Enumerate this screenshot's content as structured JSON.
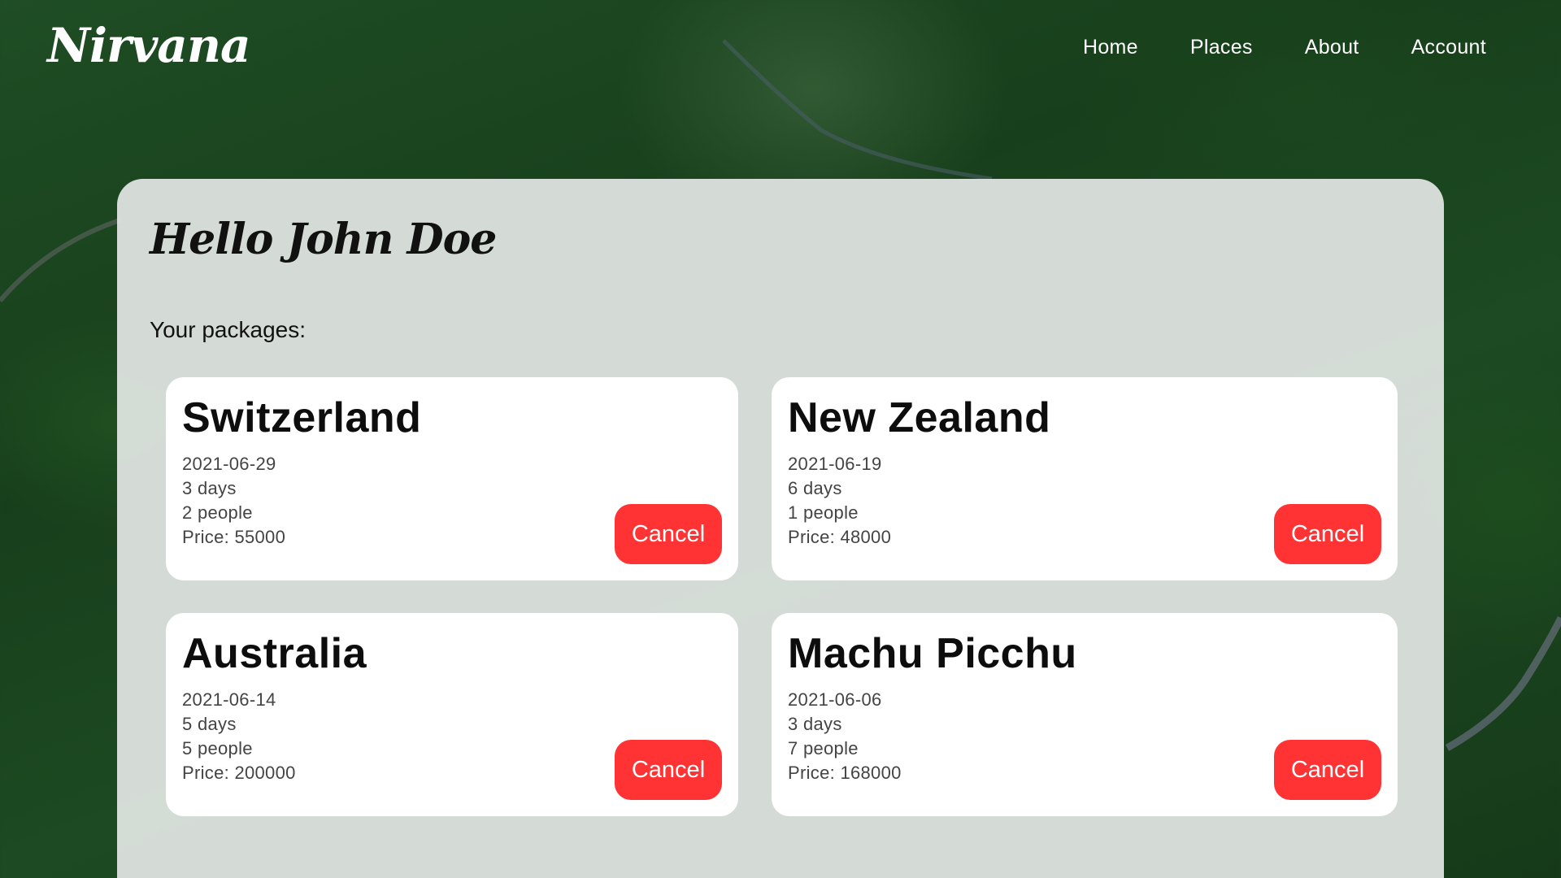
{
  "brand": {
    "logo": "Nirvana"
  },
  "nav": {
    "items": [
      {
        "label": "Home"
      },
      {
        "label": "Places"
      },
      {
        "label": "About"
      },
      {
        "label": "Account"
      }
    ]
  },
  "main": {
    "greeting": "Hello John Doe",
    "packages_label": "Your packages:",
    "packages": [
      {
        "destination": "Switzerland",
        "date": "2021-06-29",
        "duration": "3 days",
        "people": "2 people",
        "price": "Price: 55000",
        "cancel_label": "Cancel"
      },
      {
        "destination": "New Zealand",
        "date": "2021-06-19",
        "duration": "6 days",
        "people": "1 people",
        "price": "Price: 48000",
        "cancel_label": "Cancel"
      },
      {
        "destination": "Australia",
        "date": "2021-06-14",
        "duration": "5 days",
        "people": "5 people",
        "price": "Price: 200000",
        "cancel_label": "Cancel"
      },
      {
        "destination": "Machu Picchu",
        "date": "2021-06-06",
        "duration": "3 days",
        "people": "7 people",
        "price": "Price: 168000",
        "cancel_label": "Cancel"
      }
    ]
  },
  "colors": {
    "cancel_button": "#ff3333",
    "panel": "#dee4e0",
    "card": "#ffffff",
    "background": "#1f4d24"
  }
}
